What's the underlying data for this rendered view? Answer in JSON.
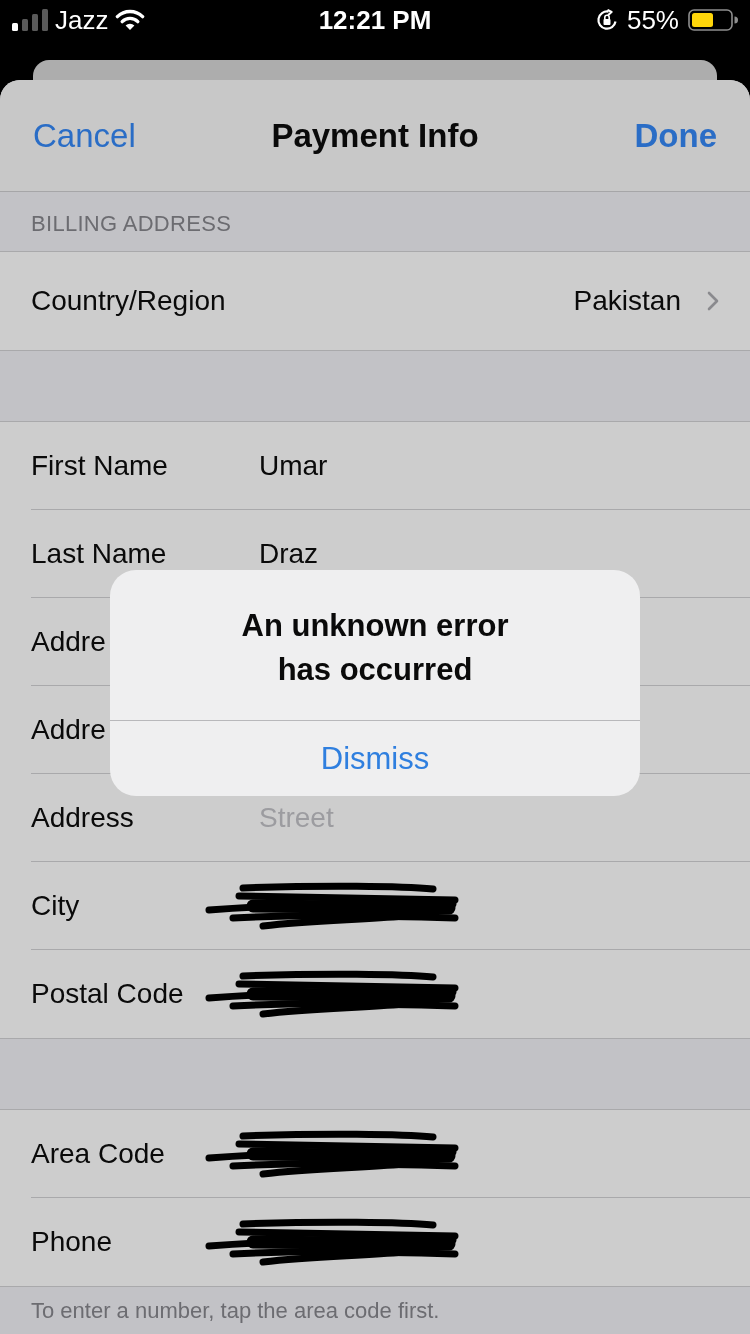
{
  "status_bar": {
    "carrier": "Jazz",
    "time": "12:21 PM",
    "battery": "55%"
  },
  "nav_bar": {
    "cancel": "Cancel",
    "title": "Payment Info",
    "done": "Done"
  },
  "sections": [
    {
      "header": "BILLING ADDRESS",
      "rows": [
        {
          "kind": "disclosure",
          "label": "Country/Region",
          "value": "Pakistan"
        }
      ]
    },
    {
      "rows": [
        {
          "kind": "field",
          "label": "First Name",
          "value": "Umar",
          "redacted": false
        },
        {
          "kind": "field",
          "label": "Last Name",
          "value": "Draz",
          "redacted": false
        },
        {
          "kind": "field",
          "label": "Addre",
          "redacted": false
        },
        {
          "kind": "field",
          "label": "Addre",
          "redacted": false
        },
        {
          "kind": "field",
          "label": "Address",
          "placeholder": "Street",
          "redacted": false
        },
        {
          "kind": "field",
          "label": "City",
          "redacted": true
        },
        {
          "kind": "field",
          "label": "Postal Code",
          "redacted": true
        }
      ]
    },
    {
      "rows": [
        {
          "kind": "field",
          "label": "Area Code",
          "redacted": true
        },
        {
          "kind": "field",
          "label": "Phone",
          "redacted": true
        }
      ],
      "footer": "To enter a number, tap the area code first."
    }
  ],
  "alert": {
    "title": "An unknown error has occurred",
    "buttons": [
      "Dismiss"
    ]
  }
}
